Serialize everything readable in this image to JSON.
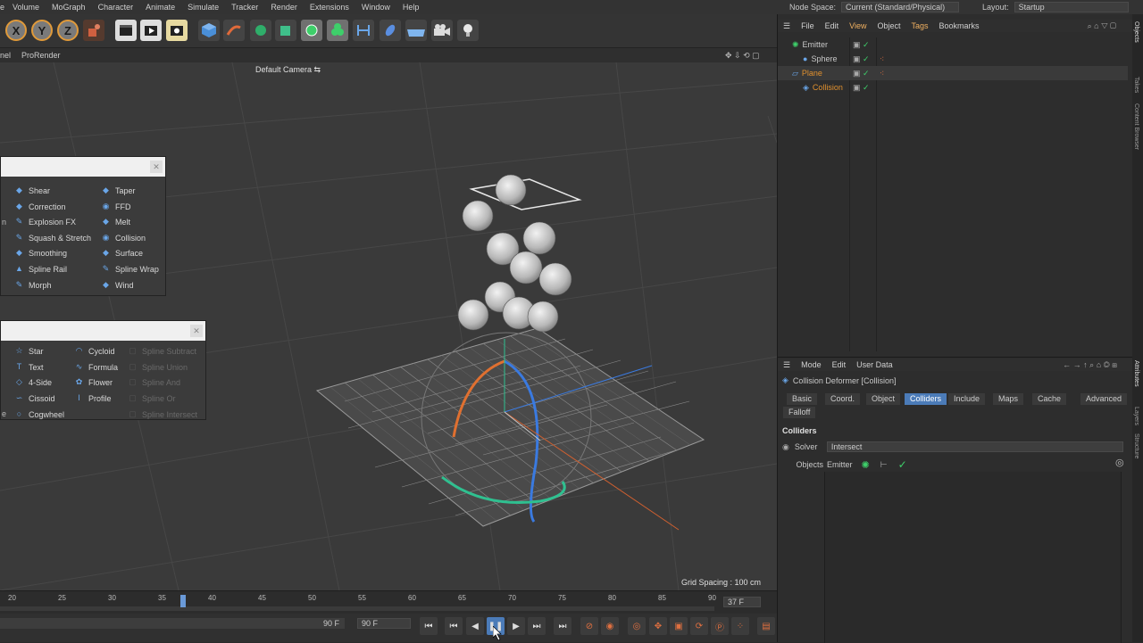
{
  "menu": [
    "Volume",
    "MoGraph",
    "Character",
    "Animate",
    "Simulate",
    "Tracker",
    "Render",
    "Extensions",
    "Window",
    "Help"
  ],
  "node_space": {
    "label": "Node Space:",
    "value": "Current (Standard/Physical)"
  },
  "layout": {
    "label": "Layout:",
    "value": "Startup"
  },
  "toolbar": {
    "x": "X",
    "y": "Y",
    "z": "Z"
  },
  "viewport_menu": [
    "nel",
    "ProRender"
  ],
  "camera_label": "Default Camera",
  "grid_spacing": "Grid Spacing : 100 cm",
  "deformer_menu": {
    "left": [
      {
        "label": "Shear",
        "icon": "shear-icon"
      },
      {
        "label": "Correction",
        "icon": "correction-icon"
      },
      {
        "label": "Explosion FX",
        "icon": "explosion-icon"
      },
      {
        "label": "Squash & Stretch",
        "icon": "squash-icon"
      },
      {
        "label": "Smoothing",
        "icon": "smoothing-icon"
      },
      {
        "label": "Spline Rail",
        "icon": "spline-rail-icon"
      },
      {
        "label": "Morph",
        "icon": "morph-icon"
      }
    ],
    "right": [
      {
        "label": "Taper",
        "icon": "taper-icon"
      },
      {
        "label": "FFD",
        "icon": "ffd-icon"
      },
      {
        "label": "Melt",
        "icon": "melt-icon"
      },
      {
        "label": "Collision",
        "icon": "collision-icon"
      },
      {
        "label": "Surface",
        "icon": "surface-icon"
      },
      {
        "label": "Spline Wrap",
        "icon": "spline-wrap-icon"
      },
      {
        "label": "Wind",
        "icon": "wind-icon"
      }
    ],
    "edge_marks": [
      "n",
      "e"
    ]
  },
  "spline_menu": {
    "left": [
      "Star",
      "Text",
      "4-Side",
      "Cissoid",
      "Cogwheel"
    ],
    "middle": [
      "Cycloid",
      "Formula",
      "Flower",
      "Profile"
    ],
    "right_disabled": [
      "Spline Subtract",
      "Spline Union",
      "Spline And",
      "Spline Or",
      "Spline Intersect"
    ]
  },
  "timeline": {
    "ticks": [
      "20",
      "25",
      "30",
      "35",
      "40",
      "45",
      "50",
      "55",
      "60",
      "65",
      "70",
      "75",
      "80",
      "85",
      "90"
    ],
    "current_frame": "37 F",
    "start_field": "90 F",
    "end_field": "90 F",
    "playhead_frame": 37
  },
  "object_manager": {
    "menu": [
      "File",
      "Edit",
      "View",
      "Object",
      "Tags",
      "Bookmarks"
    ],
    "rows": [
      {
        "name": "Emitter",
        "indent": 0,
        "color": "#d8d8d8"
      },
      {
        "name": "Sphere",
        "indent": 1,
        "color": "#d8d8d8"
      },
      {
        "name": "Plane",
        "indent": 0,
        "color": "#e0902e"
      },
      {
        "name": "Collision",
        "indent": 1,
        "color": "#e0902e"
      }
    ]
  },
  "attributes": {
    "menu": [
      "Mode",
      "Edit",
      "User Data"
    ],
    "title": "Collision Deformer [Collision]",
    "tabs": [
      "Basic",
      "Coord.",
      "Object",
      "Colliders",
      "Include",
      "Maps",
      "Cache",
      "Advanced"
    ],
    "tabs_row2": [
      "Falloff"
    ],
    "active_tab": "Colliders",
    "section": "Colliders",
    "solver_label": "Solver",
    "solver_value": "Intersect",
    "objects_label": "Objects",
    "objects_value": "Emitter"
  },
  "side_tabs": [
    "Objects",
    "Takes",
    "Content Browser",
    "Attributes",
    "Layers",
    "Structure"
  ],
  "colors": {
    "accent": "#4b7bb8",
    "orange": "#e0902e",
    "green": "#3ecf6a"
  }
}
